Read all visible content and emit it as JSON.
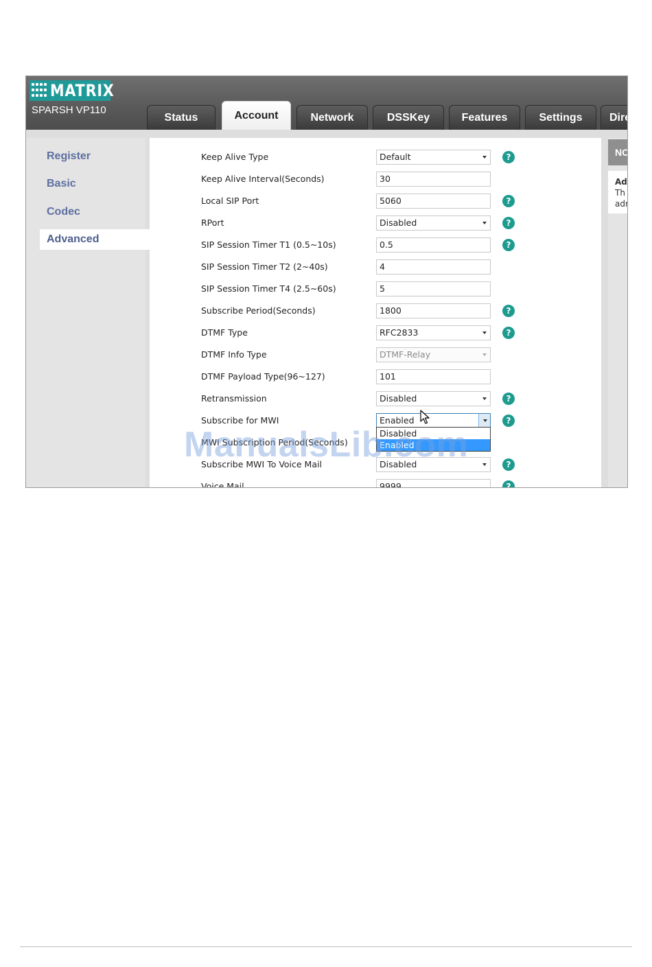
{
  "brand": {
    "logo_text": "MATRIX",
    "model": "SPARSH VP110",
    "accent": "#1f9a98"
  },
  "tabs": [
    {
      "label": "Status"
    },
    {
      "label": "Account"
    },
    {
      "label": "Network"
    },
    {
      "label": "DSSKey"
    },
    {
      "label": "Features"
    },
    {
      "label": "Settings"
    },
    {
      "label": "Dire"
    }
  ],
  "active_tab": "Account",
  "sidebar": {
    "items": [
      {
        "label": "Register"
      },
      {
        "label": "Basic"
      },
      {
        "label": "Codec"
      },
      {
        "label": "Advanced"
      }
    ],
    "active": "Advanced"
  },
  "form": {
    "rows": [
      {
        "label": "Keep Alive Type",
        "value": "Default",
        "type": "select",
        "help": "?"
      },
      {
        "label": "Keep Alive Interval(Seconds)",
        "value": "30",
        "type": "text",
        "help": ""
      },
      {
        "label": "Local SIP Port",
        "value": "5060",
        "type": "text",
        "help": "?"
      },
      {
        "label": "RPort",
        "value": "Disabled",
        "type": "select",
        "help": "?"
      },
      {
        "label": "SIP Session Timer T1 (0.5~10s)",
        "value": "0.5",
        "type": "text",
        "help": "?"
      },
      {
        "label": "SIP Session Timer T2 (2~40s)",
        "value": "4",
        "type": "text",
        "help": ""
      },
      {
        "label": "SIP Session Timer T4 (2.5~60s)",
        "value": "5",
        "type": "text",
        "help": ""
      },
      {
        "label": "Subscribe Period(Seconds)",
        "value": "1800",
        "type": "text",
        "help": "?"
      },
      {
        "label": "DTMF Type",
        "value": "RFC2833",
        "type": "select",
        "help": "?"
      },
      {
        "label": "DTMF Info Type",
        "value": "DTMF-Relay",
        "type": "select-disabled",
        "help": ""
      },
      {
        "label": "DTMF Payload Type(96~127)",
        "value": "101",
        "type": "text",
        "help": ""
      },
      {
        "label": "Retransmission",
        "value": "Disabled",
        "type": "select",
        "help": "?"
      },
      {
        "label": "Subscribe for MWI",
        "value": "Enabled",
        "type": "select-open",
        "help": "?"
      },
      {
        "label": "MWI Subscription Period(Seconds)",
        "value": "",
        "type": "hidden",
        "help": ""
      },
      {
        "label": "Subscribe MWI To Voice Mail",
        "value": "Disabled",
        "type": "select",
        "help": "?"
      },
      {
        "label": "Voice Mail",
        "value": "9999",
        "type": "text",
        "help": "?"
      }
    ]
  },
  "mwi_dropdown": {
    "options": [
      {
        "label": "Disabled",
        "selected": false
      },
      {
        "label": "Enabled",
        "selected": true
      }
    ]
  },
  "note_panel": {
    "title": "NO",
    "body_title": "Ad",
    "body_lines": [
      "Th",
      "adr"
    ]
  },
  "watermark": "ManualsLib.com"
}
